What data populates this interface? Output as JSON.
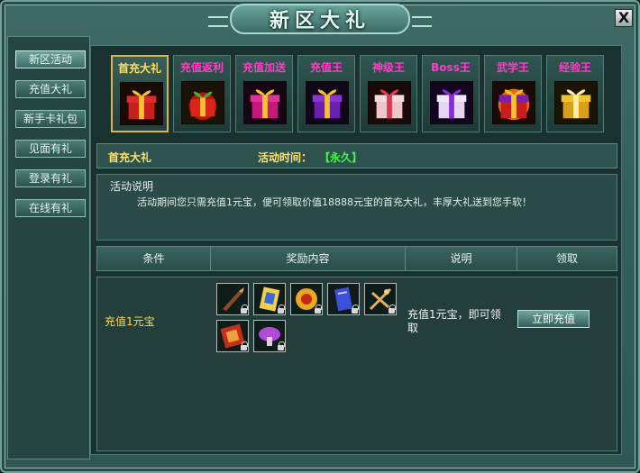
{
  "window": {
    "title": "新区大礼",
    "close_label": "X"
  },
  "sidebar": {
    "items": [
      {
        "label": "新区活动",
        "active": true
      },
      {
        "label": "充值大礼",
        "active": false
      },
      {
        "label": "新手卡礼包",
        "active": false
      },
      {
        "label": "见面有礼",
        "active": false
      },
      {
        "label": "登录有礼",
        "active": false
      },
      {
        "label": "在线有礼",
        "active": false
      }
    ]
  },
  "tabs": [
    {
      "label": "首充大礼",
      "icon": "gift-red-gold-icon",
      "active": true
    },
    {
      "label": "充值返利",
      "icon": "gift-green-red-icon",
      "active": false
    },
    {
      "label": "充值加送",
      "icon": "gift-magenta-icon",
      "active": false
    },
    {
      "label": "充值王",
      "icon": "gift-purple-gold-icon",
      "active": false
    },
    {
      "label": "神级王",
      "icon": "gift-pink-icon",
      "active": false
    },
    {
      "label": "Boss王",
      "icon": "gift-violet-icon",
      "active": false
    },
    {
      "label": "武学王",
      "icon": "gift-red-orange-icon",
      "active": false
    },
    {
      "label": "经验王",
      "icon": "gift-gold-icon",
      "active": false
    }
  ],
  "activity": {
    "name": "首充大礼",
    "time_label": "活动时间：",
    "time_value": "【永久】",
    "desc_title": "活动说明",
    "desc_text": "活动期间您只需充值1元宝，便可领取价值18888元宝的首充大礼，丰厚大礼送到您手软！"
  },
  "table": {
    "headers": [
      "条件",
      "奖励内容",
      "说明",
      "领取"
    ],
    "row": {
      "condition": "充值1元宝",
      "rewards": [
        {
          "icon": "saber-weapon-icon",
          "locked": true
        },
        {
          "icon": "gold-scroll-icon",
          "locked": true
        },
        {
          "icon": "gold-medallion-icon",
          "locked": true
        },
        {
          "icon": "blue-book-icon",
          "locked": true
        },
        {
          "icon": "spear-cross-icon",
          "locked": true
        },
        {
          "icon": "red-token-icon",
          "locked": true
        },
        {
          "icon": "purple-mushroom-icon",
          "locked": true
        }
      ],
      "note": "充值1元宝，即可领取",
      "action_label": "立即充值"
    }
  },
  "colors": {
    "accent_gold": "#ffe26a",
    "tab_pink": "#ff3cc8",
    "time_green": "#3bff3b"
  }
}
